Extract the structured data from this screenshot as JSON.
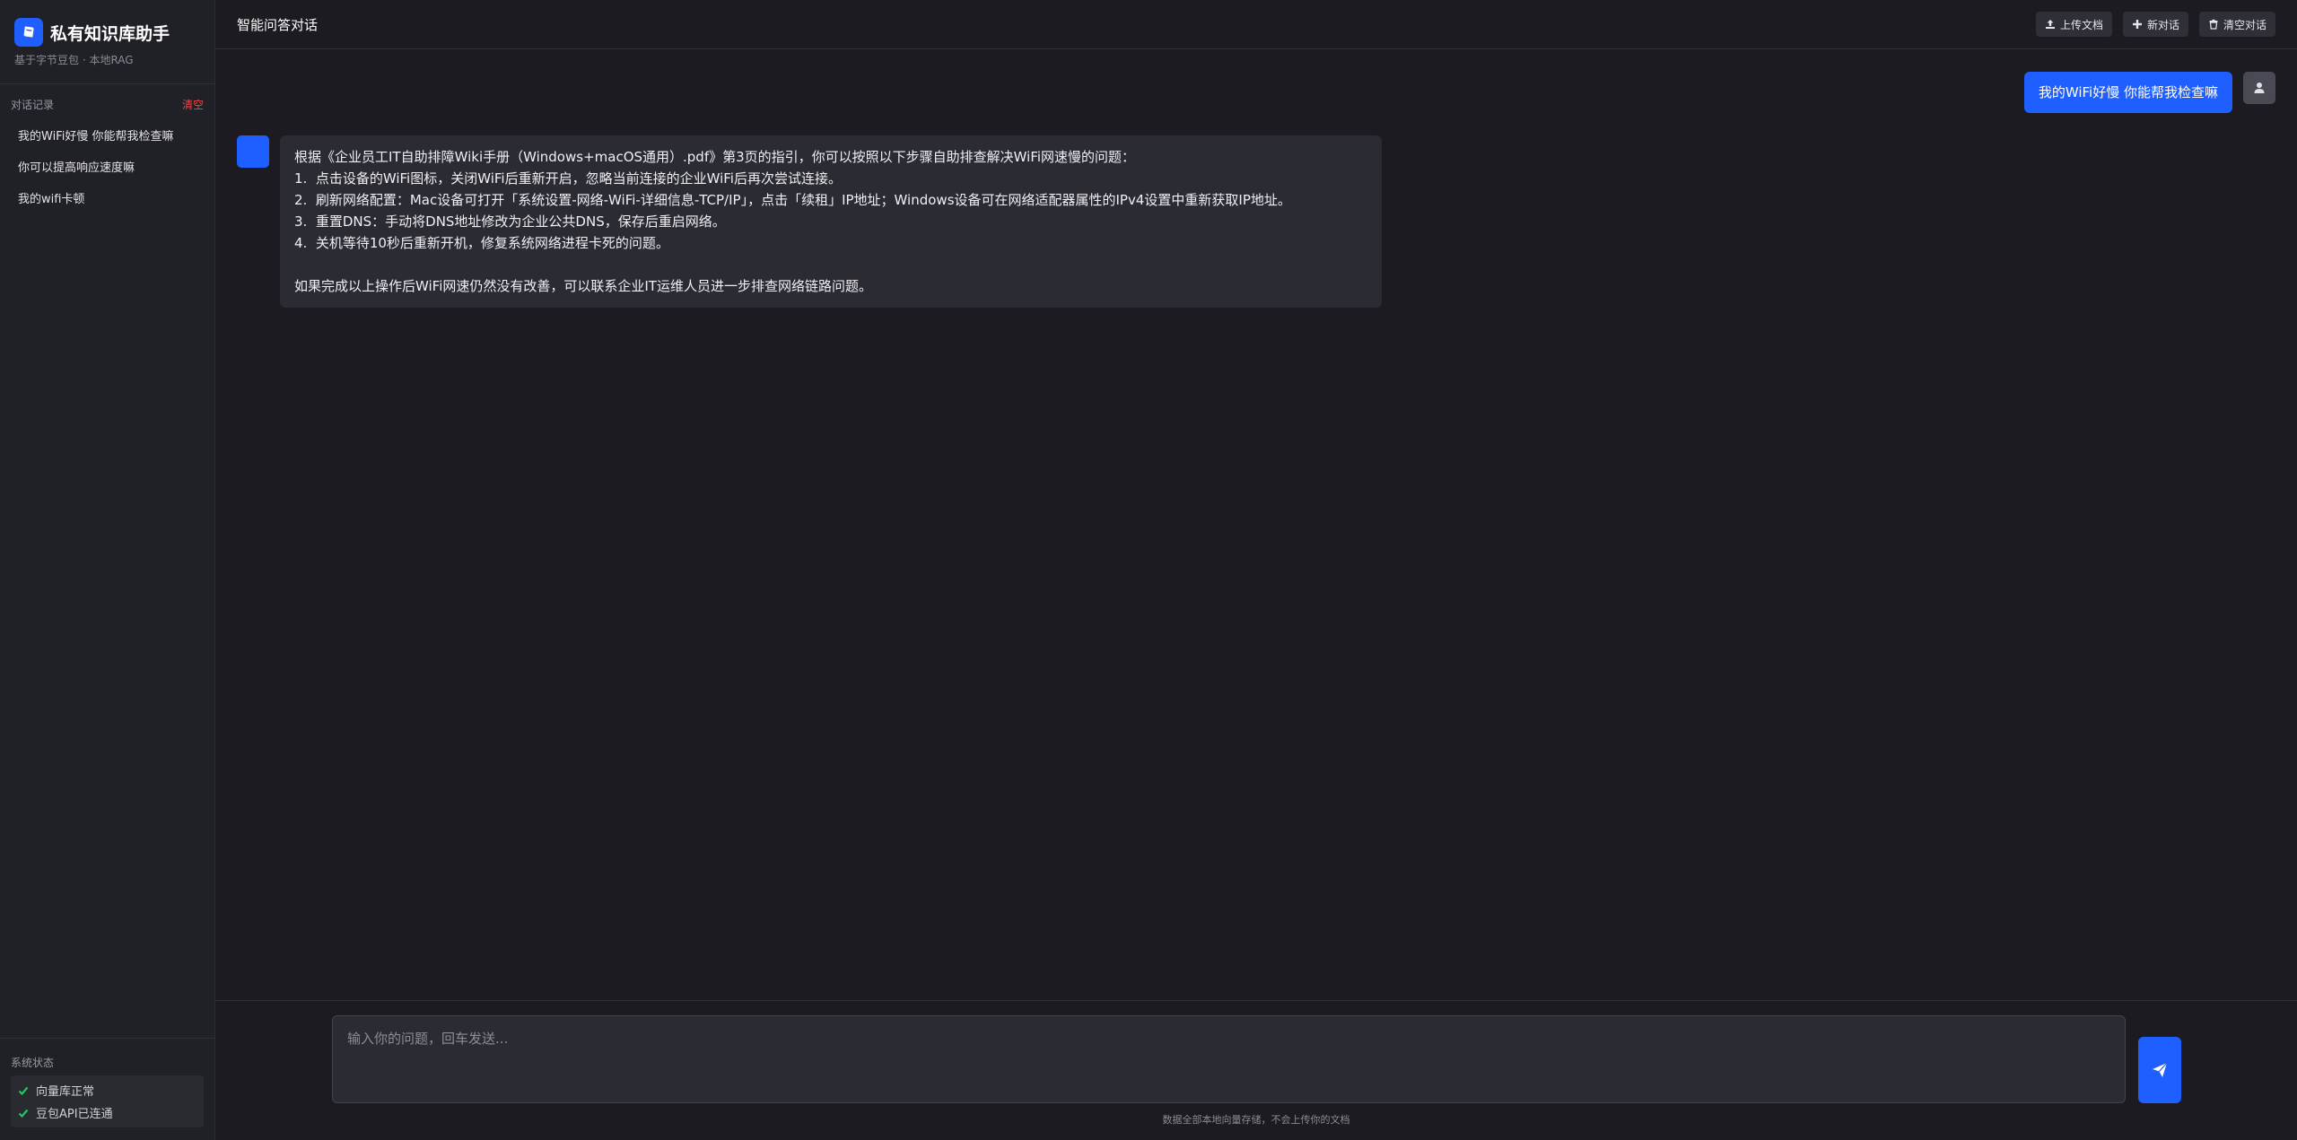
{
  "sidebar": {
    "title": "私有知识库助手",
    "subtitle": "基于字节豆包 · 本地RAG",
    "history_label": "对话记录",
    "clear_label": "清空",
    "items": [
      {
        "label": "我的WiFi好慢 你能帮我检查嘛"
      },
      {
        "label": "你可以提高响应速度嘛"
      },
      {
        "label": "我的wifi卡顿"
      }
    ],
    "status_label": "系统状态",
    "status": [
      {
        "label": "向量库正常"
      },
      {
        "label": "豆包API已连通"
      }
    ]
  },
  "header": {
    "title": "智能问答对话",
    "upload_label": "上传文档",
    "new_chat_label": "新对话",
    "clear_chat_label": "清空对话"
  },
  "chat": {
    "user_message": "我的WiFi好慢 你能帮我检查嘛",
    "bot_lines": [
      "根据《企业员工IT自助排障Wiki手册（Windows+macOS通用）.pdf》第3页的指引，你可以按照以下步骤自助排查解决WiFi网速慢的问题：",
      "1.  点击设备的WiFi图标，关闭WiFi后重新开启，忽略当前连接的企业WiFi后再次尝试连接。",
      "2.  刷新网络配置：Mac设备可打开「系统设置-网络-WiFi-详细信息-TCP/IP」，点击「续租」IP地址；Windows设备可在网络适配器属性的IPv4设置中重新获取IP地址。",
      "3.  重置DNS：手动将DNS地址修改为企业公共DNS，保存后重启网络。",
      "4.  关机等待10秒后重新开机，修复系统网络进程卡死的问题。"
    ],
    "bot_closing": "如果完成以上操作后WiFi网速仍然没有改善，可以联系企业IT运维人员进一步排查网络链路问题。"
  },
  "composer": {
    "placeholder": "输入你的问题，回车发送...",
    "note": "数据全部本地向量存储，不会上传你的文档"
  },
  "colors": {
    "accent": "#1f5eff",
    "danger": "#ef4444",
    "success": "#22c55e"
  }
}
